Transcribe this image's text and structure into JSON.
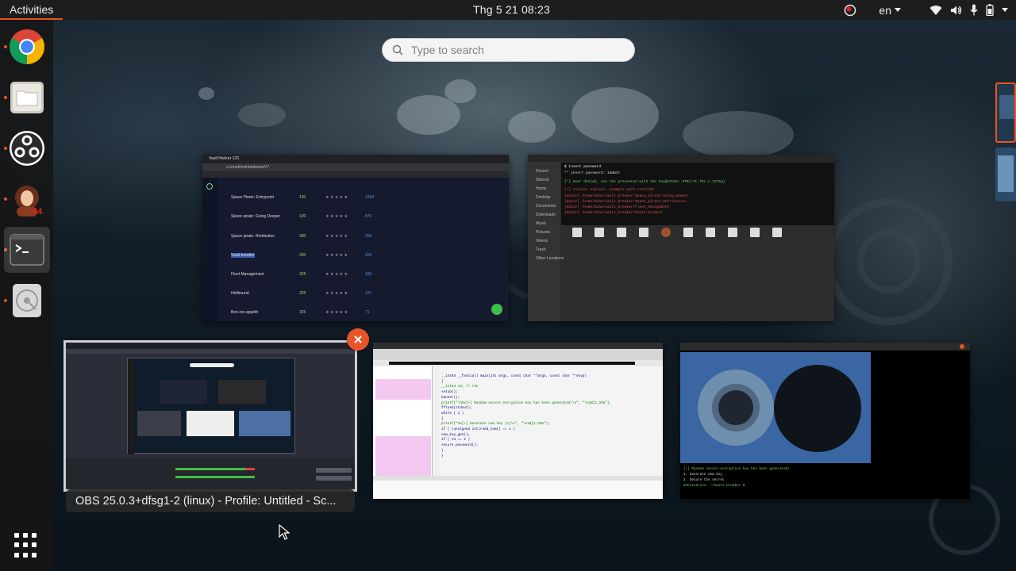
{
  "topbar": {
    "activities_label": "Activities",
    "clock": "Thg 5 21  08:23",
    "keyboard_layout": "en"
  },
  "search": {
    "placeholder": "Type to search"
  },
  "dock": {
    "items": [
      {
        "name": "Google Chrome",
        "icon": "chrome-icon",
        "running": true
      },
      {
        "name": "Files",
        "icon": "files-icon",
        "running": true
      },
      {
        "name": "OBS Studio",
        "icon": "obs-icon",
        "running": true
      },
      {
        "name": "Avatar app",
        "icon": "avatar-app-icon",
        "running": true
      },
      {
        "name": "Terminal",
        "icon": "terminal-icon",
        "running": true,
        "active": true
      },
      {
        "name": "Disks",
        "icon": "disk-icon",
        "running": true
      }
    ],
    "show_applications_icon": "app-grid-icon"
  },
  "windows": {
    "browser": {
      "tab_title": "Vault Hacker 123",
      "url": "v.1mod/rivimbeleeuw/V7",
      "rows": [
        {
          "name": "Space Pirate: Entrypoint",
          "score": "100",
          "solves": "1209"
        },
        {
          "name": "Space pirate: Going Deeper",
          "score": "100",
          "solves": "876"
        },
        {
          "name": "Space pirate: Retribution",
          "score": "300",
          "solves": "356"
        },
        {
          "name": "Vault-breaker",
          "score": "300",
          "solves": "294"
        },
        {
          "name": "Fleet Management",
          "score": "325",
          "solves": "183"
        },
        {
          "name": "Hellbound",
          "score": "325",
          "solves": "127"
        },
        {
          "name": "Bon-nie-appétit",
          "score": "325",
          "solves": "71"
        }
      ]
    },
    "files": {
      "terminal_lines": [
        "$ insert password",
        "** insert password: 1mdmst",
        "[*] User denied, use the presented with the key@ACHUA: HTB{r3t_f0r_r_1375g}",
        "[+] Analyze exploit, example with ret2libc",
        "[$obit] /home/mibe/vault_breaker/Space_pirate_Going_Deeper",
        "[$obit] /home/mibe/vault_breaker/Space_pirate_Retribution",
        "[$obit] /home/mibe/vault_breaker/Fleet_Management",
        "[$obit] /home/mibe/vault_breaker/Vault-breaker"
      ],
      "sidebar": [
        "Recent",
        "Starred",
        "Home",
        "Desktop",
        "Documents",
        "Downloads",
        "Music",
        "Pictures",
        "Videos",
        "Trash",
        "Other Locations"
      ]
    },
    "obs": {
      "caption": "OBS 25.0.3+dfsg1-2 (linux) - Profile: Untitled - Sc..."
    },
    "ida": {
      "code_lines": [
        "__int64 __fastcall main(int argc, const char **argv, const char **envp)",
        "{",
        "  __int64 v3; // rdx",
        "  setup();",
        "  banner();",
        "  printf(\"\\n%s[+] Random secure encryption key has been generated!\\n\", \"\\x1B[1;33m\");",
        "  fflush(stdout);",
        "  while ( 1 )",
        "  {",
        "    printf(\"%s[+] Generate new key (x)\\n\", \"\\x1B[1;34m\");",
        "    if ( (unsigned int)read_num() == 1 )",
        "      new_key_gen();",
        "    if ( v3 == 2 )",
        "      secure_password();",
        "  }",
        "}"
      ]
    },
    "terminal": {
      "lines": [
        "[+] Random secure encryption key has been generated!",
        "1. Generate new key",
        "2. Secure the secret",
        "$obituaries: ~/Vault-breaker $ "
      ]
    }
  },
  "colors": {
    "accent": "#e95420",
    "topbar": "#1d1d1d",
    "dock": "#161616"
  }
}
